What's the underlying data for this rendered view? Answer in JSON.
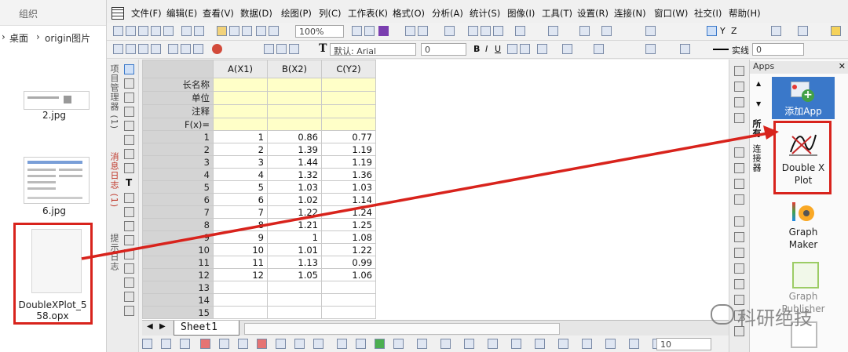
{
  "explorer": {
    "group_header": "组织",
    "breadcrumb": [
      "桌面",
      "origin图片"
    ],
    "files": [
      {
        "name": "2.jpg"
      },
      {
        "name": "6.jpg"
      },
      {
        "name": "DoubleXPlot_5\n58.opx"
      }
    ]
  },
  "menu": [
    "文件(F)",
    "编辑(E)",
    "查看(V)",
    "数据(D)",
    "绘图(P)",
    "列(C)",
    "工作表(K)",
    "格式(O)",
    "分析(A)",
    "统计(S)",
    "图像(I)",
    "工具(T)",
    "设置(R)",
    "连接(N)",
    "窗口(W)",
    "社交(I)",
    "帮助(H)"
  ],
  "toolbar": {
    "zoom": "100%",
    "font": "默认: Arial",
    "font_size": "0",
    "line_style": "实线",
    "line_width": "0",
    "zoom_level_bottom": "10"
  },
  "left_tabs": [
    "项目管理器 (1)",
    "消息日志 (1)",
    "提示日志"
  ],
  "worksheet": {
    "columns": [
      "A(X1)",
      "B(X2)",
      "C(Y2)"
    ],
    "meta_rows": [
      "长名称",
      "单位",
      "注释",
      "F(x)="
    ],
    "rows": [
      [
        "1",
        "1",
        "0.86",
        "0.77"
      ],
      [
        "2",
        "2",
        "1.39",
        "1.19"
      ],
      [
        "3",
        "3",
        "1.44",
        "1.19"
      ],
      [
        "4",
        "4",
        "1.32",
        "1.36"
      ],
      [
        "5",
        "5",
        "1.03",
        "1.03"
      ],
      [
        "6",
        "6",
        "1.02",
        "1.14"
      ],
      [
        "7",
        "7",
        "1.22",
        "1.24"
      ],
      [
        "8",
        "8",
        "1.21",
        "1.25"
      ],
      [
        "9",
        "9",
        "1",
        "1.08"
      ],
      [
        "10",
        "10",
        "1.01",
        "1.22"
      ],
      [
        "11",
        "11",
        "1.13",
        "0.99"
      ],
      [
        "12",
        "12",
        "1.05",
        "1.06"
      ],
      [
        "13",
        "",
        "",
        ""
      ],
      [
        "14",
        "",
        "",
        ""
      ],
      [
        "15",
        "",
        "",
        ""
      ]
    ],
    "sheet_tab": "Sheet1"
  },
  "right_strip_tabs": [
    "所有",
    "连接器"
  ],
  "apps_panel": {
    "title": "Apps",
    "items": [
      "添加App",
      "Double X\nPlot",
      "Graph\nMaker",
      "Graph\nPublisher"
    ]
  },
  "watermark": "科研绝技",
  "colors": {
    "highlight_red": "#d8231c",
    "meta_yellow": "#ffffc8",
    "selected_app": "#3a78c9"
  }
}
